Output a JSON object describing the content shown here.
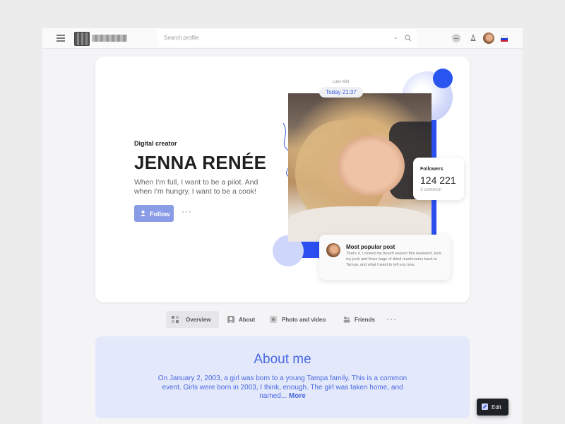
{
  "header": {
    "search_placeholder": "Search profile",
    "flag_colors": [
      "#ffffff",
      "#1c3fd8",
      "#e02020"
    ]
  },
  "profile": {
    "subtitle": "Digital creator",
    "name": "JENNA RENÉE",
    "bio": "When I'm full, I want to be a pilot. And when I'm hungry, I want to be a cook!",
    "follow_label": "Follow",
    "more_label": "···",
    "last_visit_label": "Last visit",
    "last_visit_value": "Today 21:37",
    "followers_title": "Followers",
    "followers_count": "124 221",
    "followers_common": "3 common",
    "popular_post_title": "Most popular post",
    "popular_post_text": "That's it, I closed my beach season this weekend, took my junk and three bags of dried mushrooms back to Tampa, and what I want to tell you now."
  },
  "tabs": {
    "items": [
      {
        "label": "Overview",
        "icon": "grid-icon",
        "active": true
      },
      {
        "label": "About",
        "icon": "person-icon",
        "active": false
      },
      {
        "label": "Photo and video",
        "icon": "photo-icon",
        "active": false
      },
      {
        "label": "Friends",
        "icon": "friends-icon",
        "active": false
      }
    ],
    "more_label": "···"
  },
  "about": {
    "title": "About me",
    "text": "On January 2, 2003, a girl was born to a young Tampa family. This is a common event. Girls were born in 2003, I think, enough. The girl was taken home, and named...",
    "more_label": "More"
  },
  "edit": {
    "label": "Edit"
  },
  "colors": {
    "accent_blue": "#2b55f0",
    "follow_button": "#8b9ce6",
    "about_bg": "#e3e8fb",
    "about_text": "#4a6ae0"
  }
}
